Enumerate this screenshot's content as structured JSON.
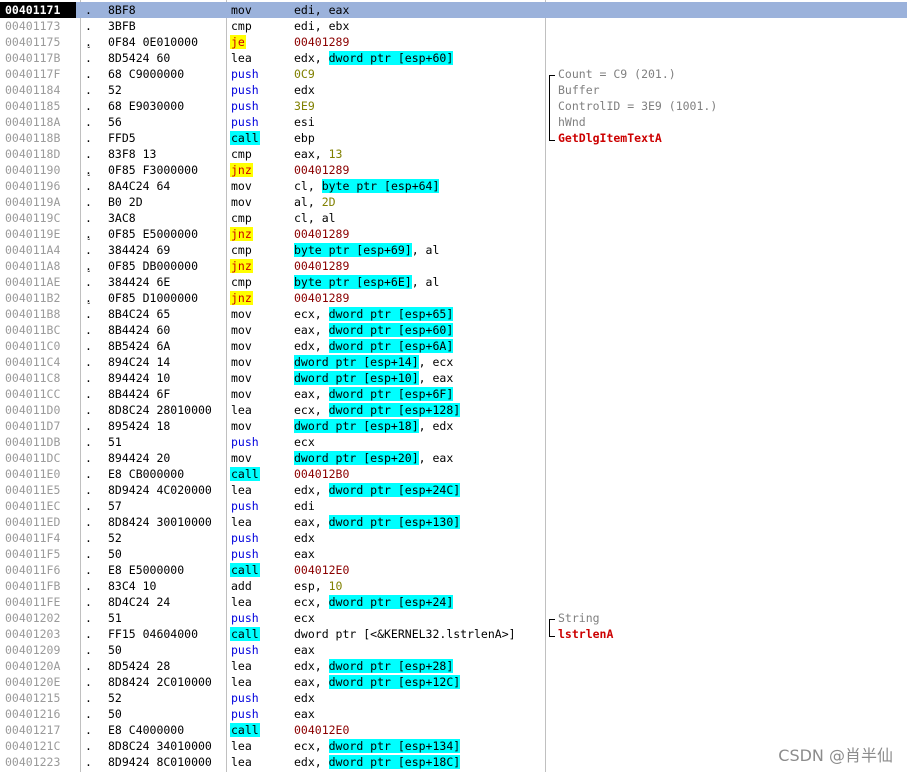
{
  "rows": [
    {
      "addr": "00401171",
      "m": ".",
      "arrow": "",
      "hex": "8BF8",
      "mn": "mov",
      "ops": [
        [
          "edi, eax",
          ""
        ]
      ],
      "cmt": [],
      "sel": true
    },
    {
      "addr": "00401173",
      "m": ".",
      "arrow": "",
      "hex": "3BFB",
      "mn": "cmp",
      "ops": [
        [
          "edi, ebx",
          ""
        ]
      ],
      "cmt": []
    },
    {
      "addr": "00401175",
      "m": ".",
      "arrow": "v",
      "hex": "0F84 0E010000",
      "mn": "je",
      "ops": [
        [
          "00401289",
          "tgt"
        ]
      ],
      "cmt": []
    },
    {
      "addr": "0040117B",
      "m": ".",
      "arrow": "",
      "hex": "8D5424 60",
      "mn": "lea",
      "ops": [
        [
          "edx, ",
          ""
        ],
        [
          "dword ptr [esp+60]",
          "mem"
        ]
      ],
      "cmt": []
    },
    {
      "addr": "0040117F",
      "m": ".",
      "arrow": "",
      "hex": "68 C9000000",
      "mn": "push",
      "ops": [
        [
          "0C9",
          "num"
        ]
      ],
      "cmt": [
        [
          "Count = C9 (201.)",
          "param"
        ]
      ]
    },
    {
      "addr": "00401184",
      "m": ".",
      "arrow": "",
      "hex": "52",
      "mn": "push",
      "ops": [
        [
          "edx",
          ""
        ]
      ],
      "cmt": [
        [
          "Buffer",
          "param"
        ]
      ]
    },
    {
      "addr": "00401185",
      "m": ".",
      "arrow": "",
      "hex": "68 E9030000",
      "mn": "push",
      "ops": [
        [
          "3E9",
          "num"
        ]
      ],
      "cmt": [
        [
          "ControlID = 3E9 (1001.)",
          "param"
        ]
      ]
    },
    {
      "addr": "0040118A",
      "m": ".",
      "arrow": "",
      "hex": "56",
      "mn": "push",
      "ops": [
        [
          "esi",
          ""
        ]
      ],
      "cmt": [
        [
          "hWnd",
          "param"
        ]
      ]
    },
    {
      "addr": "0040118B",
      "m": ".",
      "arrow": "",
      "hex": "FFD5",
      "mn": "call",
      "ops": [
        [
          "ebp",
          ""
        ]
      ],
      "cmt": [
        [
          "GetDlgItemTextA",
          "fn"
        ]
      ]
    },
    {
      "addr": "0040118D",
      "m": ".",
      "arrow": "",
      "hex": "83F8 13",
      "mn": "cmp",
      "ops": [
        [
          "eax, ",
          ""
        ],
        [
          "13",
          "num"
        ]
      ],
      "cmt": []
    },
    {
      "addr": "00401190",
      "m": ".",
      "arrow": "v",
      "hex": "0F85 F3000000",
      "mn": "jnz",
      "ops": [
        [
          "00401289",
          "tgt"
        ]
      ],
      "cmt": []
    },
    {
      "addr": "00401196",
      "m": ".",
      "arrow": "",
      "hex": "8A4C24 64",
      "mn": "mov",
      "ops": [
        [
          "cl, ",
          ""
        ],
        [
          "byte ptr [esp+64]",
          "mem"
        ]
      ],
      "cmt": []
    },
    {
      "addr": "0040119A",
      "m": ".",
      "arrow": "",
      "hex": "B0 2D",
      "mn": "mov",
      "ops": [
        [
          "al, ",
          ""
        ],
        [
          "2D",
          "num"
        ]
      ],
      "cmt": []
    },
    {
      "addr": "0040119C",
      "m": ".",
      "arrow": "",
      "hex": "3AC8",
      "mn": "cmp",
      "ops": [
        [
          "cl, al",
          ""
        ]
      ],
      "cmt": []
    },
    {
      "addr": "0040119E",
      "m": ".",
      "arrow": "v",
      "hex": "0F85 E5000000",
      "mn": "jnz",
      "ops": [
        [
          "00401289",
          "tgt"
        ]
      ],
      "cmt": []
    },
    {
      "addr": "004011A4",
      "m": ".",
      "arrow": "",
      "hex": "384424 69",
      "mn": "cmp",
      "ops": [
        [
          "byte ptr [esp+69]",
          "mem"
        ],
        [
          ", al",
          ""
        ]
      ],
      "cmt": []
    },
    {
      "addr": "004011A8",
      "m": ".",
      "arrow": "v",
      "hex": "0F85 DB000000",
      "mn": "jnz",
      "ops": [
        [
          "00401289",
          "tgt"
        ]
      ],
      "cmt": []
    },
    {
      "addr": "004011AE",
      "m": ".",
      "arrow": "",
      "hex": "384424 6E",
      "mn": "cmp",
      "ops": [
        [
          "byte ptr [esp+6E]",
          "mem"
        ],
        [
          ", al",
          ""
        ]
      ],
      "cmt": []
    },
    {
      "addr": "004011B2",
      "m": ".",
      "arrow": "v",
      "hex": "0F85 D1000000",
      "mn": "jnz",
      "ops": [
        [
          "00401289",
          "tgt"
        ]
      ],
      "cmt": []
    },
    {
      "addr": "004011B8",
      "m": ".",
      "arrow": "",
      "hex": "8B4C24 65",
      "mn": "mov",
      "ops": [
        [
          "ecx, ",
          ""
        ],
        [
          "dword ptr [esp+65]",
          "mem"
        ]
      ],
      "cmt": []
    },
    {
      "addr": "004011BC",
      "m": ".",
      "arrow": "",
      "hex": "8B4424 60",
      "mn": "mov",
      "ops": [
        [
          "eax, ",
          ""
        ],
        [
          "dword ptr [esp+60]",
          "mem"
        ]
      ],
      "cmt": []
    },
    {
      "addr": "004011C0",
      "m": ".",
      "arrow": "",
      "hex": "8B5424 6A",
      "mn": "mov",
      "ops": [
        [
          "edx, ",
          ""
        ],
        [
          "dword ptr [esp+6A]",
          "mem"
        ]
      ],
      "cmt": []
    },
    {
      "addr": "004011C4",
      "m": ".",
      "arrow": "",
      "hex": "894C24 14",
      "mn": "mov",
      "ops": [
        [
          "dword ptr [esp+14]",
          "mem"
        ],
        [
          ", ecx",
          ""
        ]
      ],
      "cmt": []
    },
    {
      "addr": "004011C8",
      "m": ".",
      "arrow": "",
      "hex": "894424 10",
      "mn": "mov",
      "ops": [
        [
          "dword ptr [esp+10]",
          "mem"
        ],
        [
          ", eax",
          ""
        ]
      ],
      "cmt": []
    },
    {
      "addr": "004011CC",
      "m": ".",
      "arrow": "",
      "hex": "8B4424 6F",
      "mn": "mov",
      "ops": [
        [
          "eax, ",
          ""
        ],
        [
          "dword ptr [esp+6F]",
          "mem"
        ]
      ],
      "cmt": []
    },
    {
      "addr": "004011D0",
      "m": ".",
      "arrow": "",
      "hex": "8D8C24 28010000",
      "mn": "lea",
      "ops": [
        [
          "ecx, ",
          ""
        ],
        [
          "dword ptr [esp+128]",
          "mem"
        ]
      ],
      "cmt": []
    },
    {
      "addr": "004011D7",
      "m": ".",
      "arrow": "",
      "hex": "895424 18",
      "mn": "mov",
      "ops": [
        [
          "dword ptr [esp+18]",
          "mem"
        ],
        [
          ", edx",
          ""
        ]
      ],
      "cmt": []
    },
    {
      "addr": "004011DB",
      "m": ".",
      "arrow": "",
      "hex": "51",
      "mn": "push",
      "ops": [
        [
          "ecx",
          ""
        ]
      ],
      "cmt": []
    },
    {
      "addr": "004011DC",
      "m": ".",
      "arrow": "",
      "hex": "894424 20",
      "mn": "mov",
      "ops": [
        [
          "dword ptr [esp+20]",
          "mem"
        ],
        [
          ", eax",
          ""
        ]
      ],
      "cmt": []
    },
    {
      "addr": "004011E0",
      "m": ".",
      "arrow": "",
      "hex": "E8 CB000000",
      "mn": "call",
      "ops": [
        [
          "004012B0",
          "tgt"
        ]
      ],
      "cmt": []
    },
    {
      "addr": "004011E5",
      "m": ".",
      "arrow": "",
      "hex": "8D9424 4C020000",
      "mn": "lea",
      "ops": [
        [
          "edx, ",
          ""
        ],
        [
          "dword ptr [esp+24C]",
          "mem"
        ]
      ],
      "cmt": []
    },
    {
      "addr": "004011EC",
      "m": ".",
      "arrow": "",
      "hex": "57",
      "mn": "push",
      "ops": [
        [
          "edi",
          ""
        ]
      ],
      "cmt": []
    },
    {
      "addr": "004011ED",
      "m": ".",
      "arrow": "",
      "hex": "8D8424 30010000",
      "mn": "lea",
      "ops": [
        [
          "eax, ",
          ""
        ],
        [
          "dword ptr [esp+130]",
          "mem"
        ]
      ],
      "cmt": []
    },
    {
      "addr": "004011F4",
      "m": ".",
      "arrow": "",
      "hex": "52",
      "mn": "push",
      "ops": [
        [
          "edx",
          ""
        ]
      ],
      "cmt": []
    },
    {
      "addr": "004011F5",
      "m": ".",
      "arrow": "",
      "hex": "50",
      "mn": "push",
      "ops": [
        [
          "eax",
          ""
        ]
      ],
      "cmt": []
    },
    {
      "addr": "004011F6",
      "m": ".",
      "arrow": "",
      "hex": "E8 E5000000",
      "mn": "call",
      "ops": [
        [
          "004012E0",
          "tgt"
        ]
      ],
      "cmt": []
    },
    {
      "addr": "004011FB",
      "m": ".",
      "arrow": "",
      "hex": "83C4 10",
      "mn": "add",
      "ops": [
        [
          "esp, ",
          ""
        ],
        [
          "10",
          "num"
        ]
      ],
      "cmt": []
    },
    {
      "addr": "004011FE",
      "m": ".",
      "arrow": "",
      "hex": "8D4C24 24",
      "mn": "lea",
      "ops": [
        [
          "ecx, ",
          ""
        ],
        [
          "dword ptr [esp+24]",
          "mem"
        ]
      ],
      "cmt": []
    },
    {
      "addr": "00401202",
      "m": ".",
      "arrow": "",
      "hex": "51",
      "mn": "push",
      "ops": [
        [
          "ecx",
          ""
        ]
      ],
      "cmt": [
        [
          "String",
          "param"
        ]
      ]
    },
    {
      "addr": "00401203",
      "m": ".",
      "arrow": "",
      "hex": "FF15 04604000",
      "mn": "call",
      "ops": [
        [
          "dword ptr [<&KERNEL32.lstrlenA>]",
          ""
        ]
      ],
      "cmt": [
        [
          "lstrlenA",
          "fn"
        ]
      ]
    },
    {
      "addr": "00401209",
      "m": ".",
      "arrow": "",
      "hex": "50",
      "mn": "push",
      "ops": [
        [
          "eax",
          ""
        ]
      ],
      "cmt": []
    },
    {
      "addr": "0040120A",
      "m": ".",
      "arrow": "",
      "hex": "8D5424 28",
      "mn": "lea",
      "ops": [
        [
          "edx, ",
          ""
        ],
        [
          "dword ptr [esp+28]",
          "mem"
        ]
      ],
      "cmt": []
    },
    {
      "addr": "0040120E",
      "m": ".",
      "arrow": "",
      "hex": "8D8424 2C010000",
      "mn": "lea",
      "ops": [
        [
          "eax, ",
          ""
        ],
        [
          "dword ptr [esp+12C]",
          "mem"
        ]
      ],
      "cmt": []
    },
    {
      "addr": "00401215",
      "m": ".",
      "arrow": "",
      "hex": "52",
      "mn": "push",
      "ops": [
        [
          "edx",
          ""
        ]
      ],
      "cmt": []
    },
    {
      "addr": "00401216",
      "m": ".",
      "arrow": "",
      "hex": "50",
      "mn": "push",
      "ops": [
        [
          "eax",
          ""
        ]
      ],
      "cmt": []
    },
    {
      "addr": "00401217",
      "m": ".",
      "arrow": "",
      "hex": "E8 C4000000",
      "mn": "call",
      "ops": [
        [
          "004012E0",
          "tgt"
        ]
      ],
      "cmt": []
    },
    {
      "addr": "0040121C",
      "m": ".",
      "arrow": "",
      "hex": "8D8C24 34010000",
      "mn": "lea",
      "ops": [
        [
          "ecx, ",
          ""
        ],
        [
          "dword ptr [esp+134]",
          "mem"
        ]
      ],
      "cmt": []
    },
    {
      "addr": "00401223",
      "m": ".",
      "arrow": "",
      "hex": "8D9424 8C010000",
      "mn": "lea",
      "ops": [
        [
          "edx, ",
          ""
        ],
        [
          "dword ptr [esp+18C]",
          "mem"
        ]
      ],
      "cmt": []
    }
  ],
  "watermark": "CSDN @肖半仙",
  "colors": {
    "selection": "#9bb2db",
    "call_highlight": "#00ffff",
    "jump_highlight": "#ffff00",
    "jump_text": "#cc0000",
    "push_text": "#0000dd",
    "api_name": "#cc0000"
  }
}
